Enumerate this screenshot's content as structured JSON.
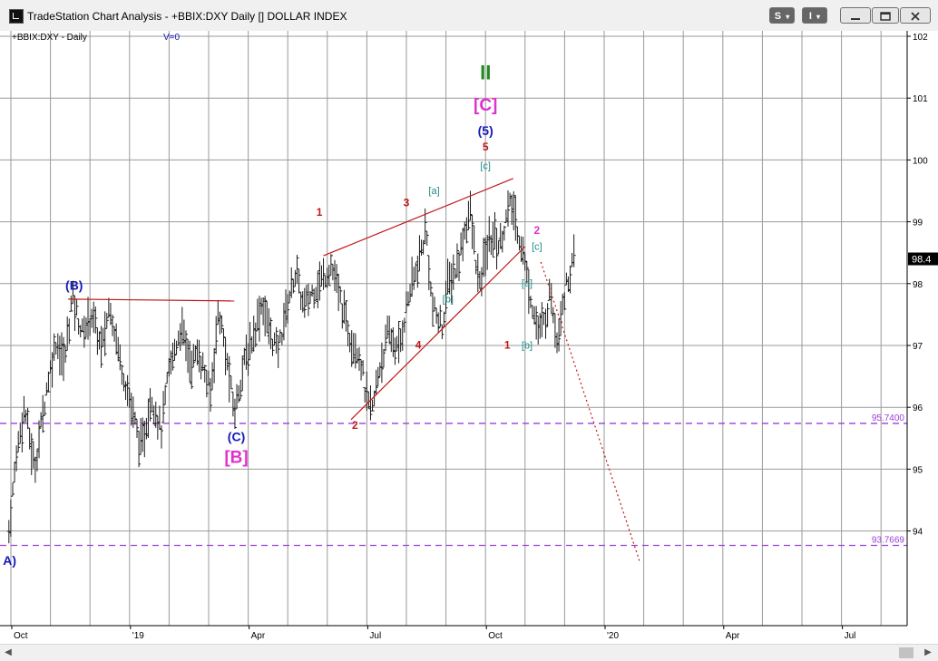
{
  "window": {
    "title": "TradeStation Chart Analysis - +BBIX:DXY Daily [] DOLLAR INDEX",
    "buttons": [
      {
        "label": "S",
        "name": "s-menu-button"
      },
      {
        "label": "I",
        "name": "i-menu-button"
      },
      {
        "label": "minimize",
        "name": "minimize-button"
      },
      {
        "label": "restore",
        "name": "restore-button"
      },
      {
        "label": "close",
        "name": "close-button"
      }
    ]
  },
  "chart_header": {
    "symbol": "+BBIX:DXY - Daily",
    "volume": "V=0"
  },
  "scrollbar": {
    "left_arrow": "◀",
    "right_arrow": "▶"
  },
  "chart_data": {
    "type": "bar",
    "symbol": "+BBIX:DXY",
    "interval": "Daily",
    "title": "",
    "ylim": [
      93.0,
      102.4
    ],
    "y_ticks": [
      94,
      95,
      96,
      97,
      98,
      99,
      100,
      101,
      102
    ],
    "x_ticks": [
      {
        "label": "Oct",
        "month": 0
      },
      {
        "label": "'19",
        "month": 3
      },
      {
        "label": "Apr",
        "month": 6
      },
      {
        "label": "Jul",
        "month": 9
      },
      {
        "label": "Oct",
        "month": 12
      },
      {
        "label": "'20",
        "month": 15
      },
      {
        "label": "Apr",
        "month": 18
      },
      {
        "label": "Jul",
        "month": 21
      }
    ],
    "last_price": "98.4",
    "grid": true,
    "price_path": [
      [
        -0.05,
        94.0
      ],
      [
        0.15,
        95.3
      ],
      [
        0.35,
        96.0
      ],
      [
        0.6,
        95.0
      ],
      [
        0.9,
        96.3
      ],
      [
        1.15,
        97.1
      ],
      [
        1.35,
        96.7
      ],
      [
        1.55,
        97.8
      ],
      [
        1.8,
        97.2
      ],
      [
        2.05,
        97.5
      ],
      [
        2.3,
        96.9
      ],
      [
        2.5,
        97.7
      ],
      [
        2.75,
        96.8
      ],
      [
        3.05,
        96.0
      ],
      [
        3.3,
        95.3
      ],
      [
        3.55,
        96.2
      ],
      [
        3.8,
        95.6
      ],
      [
        4.0,
        96.6
      ],
      [
        4.3,
        97.3
      ],
      [
        4.55,
        96.7
      ],
      [
        4.75,
        96.9
      ],
      [
        5.05,
        96.2
      ],
      [
        5.25,
        97.6
      ],
      [
        5.45,
        96.8
      ],
      [
        5.65,
        95.9
      ],
      [
        5.85,
        96.6
      ],
      [
        6.1,
        97.1
      ],
      [
        6.35,
        97.7
      ],
      [
        6.55,
        97.2
      ],
      [
        6.75,
        96.9
      ],
      [
        7.0,
        97.7
      ],
      [
        7.2,
        98.2
      ],
      [
        7.4,
        97.6
      ],
      [
        7.65,
        97.9
      ],
      [
        7.9,
        98.1
      ],
      [
        8.1,
        98.3
      ],
      [
        8.3,
        97.8
      ],
      [
        8.55,
        97.2
      ],
      [
        8.8,
        96.9
      ],
      [
        9.0,
        96.1
      ],
      [
        9.15,
        95.95
      ],
      [
        9.3,
        96.6
      ],
      [
        9.55,
        97.2
      ],
      [
        9.8,
        96.9
      ],
      [
        10.05,
        97.8
      ],
      [
        10.3,
        98.3
      ],
      [
        10.5,
        98.9
      ],
      [
        10.65,
        97.6
      ],
      [
        10.9,
        97.3
      ],
      [
        11.05,
        98.0
      ],
      [
        11.3,
        98.3
      ],
      [
        11.45,
        98.8
      ],
      [
        11.6,
        99.2
      ],
      [
        11.75,
        98.4
      ],
      [
        11.85,
        97.9
      ],
      [
        12.0,
        98.5
      ],
      [
        12.2,
        98.8
      ],
      [
        12.35,
        98.6
      ],
      [
        12.5,
        99.0
      ],
      [
        12.65,
        99.3
      ],
      [
        12.8,
        98.9
      ],
      [
        12.95,
        98.5
      ],
      [
        13.05,
        98.1
      ],
      [
        13.2,
        97.6
      ],
      [
        13.35,
        97.2
      ],
      [
        13.5,
        97.4
      ],
      [
        13.65,
        97.9
      ],
      [
        13.8,
        97.1
      ],
      [
        13.95,
        97.7
      ],
      [
        14.1,
        98.1
      ],
      [
        14.25,
        98.4
      ]
    ],
    "trend_lines": [
      {
        "name": "b-wave-upper-line",
        "from": [
          1.45,
          97.75
        ],
        "to": [
          5.65,
          97.72
        ],
        "style": "solid",
        "color": "#c01818"
      },
      {
        "name": "upper-wedge-line",
        "from": [
          7.9,
          98.45
        ],
        "to": [
          12.7,
          99.7
        ],
        "style": "solid",
        "color": "#c01818"
      },
      {
        "name": "lower-wedge-line",
        "from": [
          8.6,
          95.8
        ],
        "to": [
          13.0,
          98.6
        ],
        "style": "solid",
        "color": "#c01818"
      },
      {
        "name": "projection-line",
        "from": [
          13.4,
          98.35
        ],
        "to": [
          15.9,
          93.5
        ],
        "style": "dotted",
        "color": "#c01818"
      }
    ],
    "levels": [
      {
        "label": "95.7400",
        "value": 95.74,
        "color": "#9a3fd8"
      },
      {
        "label": "93.7669",
        "value": 93.7669,
        "color": "#9a3fd8"
      }
    ],
    "annotations": [
      {
        "text": "II",
        "month": 12.0,
        "price": 101.3,
        "color": "#1f8a1f",
        "size": 22,
        "bold": true
      },
      {
        "text": "[C]",
        "month": 12.0,
        "price": 100.8,
        "color": "#e030d0",
        "size": 19,
        "bold": true
      },
      {
        "text": "(5)",
        "month": 12.0,
        "price": 100.4,
        "color": "#141ab8",
        "size": 14,
        "bold": true
      },
      {
        "text": "5",
        "month": 12.0,
        "price": 100.15,
        "color": "#c01818",
        "size": 12,
        "bold": true
      },
      {
        "text": "[c]",
        "month": 12.0,
        "price": 99.85,
        "color": "#1f8a8a",
        "size": 11,
        "bold": false
      },
      {
        "text": "[a]",
        "month": 10.7,
        "price": 99.45,
        "color": "#1f8a8a",
        "size": 11,
        "bold": false
      },
      {
        "text": "1",
        "month": 7.8,
        "price": 99.1,
        "color": "#c01818",
        "size": 12,
        "bold": true
      },
      {
        "text": "3",
        "month": 10.0,
        "price": 99.25,
        "color": "#c01818",
        "size": 12,
        "bold": true
      },
      {
        "text": "[b]",
        "month": 11.05,
        "price": 97.7,
        "color": "#1f8a8a",
        "size": 11,
        "bold": false
      },
      {
        "text": "4",
        "month": 10.3,
        "price": 96.95,
        "color": "#c01818",
        "size": 12,
        "bold": true
      },
      {
        "text": "2",
        "month": 8.7,
        "price": 95.65,
        "color": "#c01818",
        "size": 12,
        "bold": true
      },
      {
        "text": "1",
        "month": 12.55,
        "price": 96.95,
        "color": "#c01818",
        "size": 12,
        "bold": true
      },
      {
        "text": "[b]",
        "month": 13.05,
        "price": 96.95,
        "color": "#1f8a8a",
        "size": 11,
        "bold": false
      },
      {
        "text": "[a]",
        "month": 13.05,
        "price": 97.95,
        "color": "#1f8a8a",
        "size": 11,
        "bold": false
      },
      {
        "text": "2",
        "month": 13.3,
        "price": 98.8,
        "color": "#e030d0",
        "size": 12,
        "bold": true
      },
      {
        "text": "[c]",
        "month": 13.3,
        "price": 98.55,
        "color": "#1f8a8a",
        "size": 11,
        "bold": false
      },
      {
        "text": "(B)",
        "month": 1.6,
        "price": 97.9,
        "color": "#141ab8",
        "size": 14,
        "bold": true
      },
      {
        "text": "(C)",
        "month": 5.7,
        "price": 95.45,
        "color": "#141ab8",
        "size": 14,
        "bold": true
      },
      {
        "text": "[B]",
        "month": 5.7,
        "price": 95.1,
        "color": "#e030d0",
        "size": 19,
        "bold": true
      },
      {
        "text": "A)",
        "month": -0.03,
        "price": 93.45,
        "color": "#141ab8",
        "size": 14,
        "bold": true
      }
    ]
  }
}
